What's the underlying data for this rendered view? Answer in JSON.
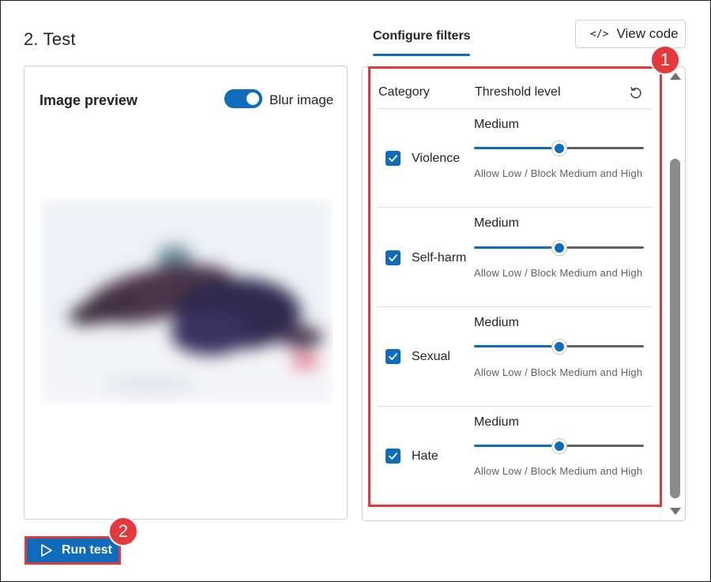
{
  "section": {
    "title": "2. Test"
  },
  "preview": {
    "title": "Image preview",
    "blur_toggle_label": "Blur image",
    "blur_toggle_on": true
  },
  "run_button": {
    "label": "Run test"
  },
  "tabs": [
    {
      "label": "Configure filters",
      "selected": true
    }
  ],
  "view_code": {
    "label": "View code",
    "icon": "code-icon"
  },
  "filters": {
    "header_category": "Category",
    "header_threshold": "Threshold level",
    "reset_icon": "reset-icon",
    "rows": [
      {
        "category": "Violence",
        "checked": true,
        "level": "Medium",
        "slider_percent": 50,
        "description": "Allow Low / Block Medium and High"
      },
      {
        "category": "Self-harm",
        "checked": true,
        "level": "Medium",
        "slider_percent": 50,
        "description": "Allow Low / Block Medium and High"
      },
      {
        "category": "Sexual",
        "checked": true,
        "level": "Medium",
        "slider_percent": 50,
        "description": "Allow Low / Block Medium and High"
      },
      {
        "category": "Hate",
        "checked": true,
        "level": "Medium",
        "slider_percent": 50,
        "description": "Allow Low / Block Medium and High"
      }
    ]
  },
  "badges": {
    "first": "1",
    "second": "2"
  },
  "colors": {
    "accent": "#0f6cbd",
    "highlight": "#e5383b"
  }
}
